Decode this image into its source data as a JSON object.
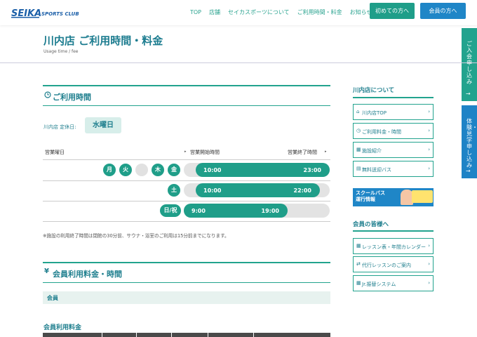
{
  "header": {
    "logo_text": "SEIKA SPORTS CLUB",
    "nav": [
      "TOP",
      "店舗",
      "セイカスポーツについて",
      "ご利用時間・料金",
      "お知らせ"
    ],
    "btn_first": "初めての方へ",
    "btn_member": "会員の方へ"
  },
  "side_tabs": {
    "apply": "ご入会申し込み",
    "trial": "体験・見学申し込み",
    "arrow": "→"
  },
  "page": {
    "title": "川内店 ご利用時間・料金",
    "subtitle": "Usage time / fee"
  },
  "hours": {
    "heading": "ご利用時間",
    "holiday_label": "川内店 定休日:",
    "holiday_value": "水曜日",
    "col_day": "営業曜日",
    "col_start": "営業開始時間",
    "col_end": "営業終了時間",
    "rows": [
      {
        "days": [
          "月",
          "火",
          "",
          "木",
          "金"
        ],
        "start": "10:00",
        "end": "23:00"
      },
      {
        "days": [
          "土"
        ],
        "start": "10:00",
        "end": "22:00"
      },
      {
        "days": [
          "日/祝"
        ],
        "start": "9:00",
        "end": "19:00"
      }
    ],
    "note": "※施設の利用終了時間は閉館の30分前、サウナ・浴室のご利用は15分前までになります。"
  },
  "fees": {
    "heading": "会員利用料金・時間",
    "icon": "¥",
    "member_label": "会員",
    "fee_title": "会員利用料金"
  },
  "sidebar": {
    "about_title": "川内店について",
    "about_links": [
      {
        "icon": "home-icon",
        "glyph": "⌂",
        "label": "川内店TOP"
      },
      {
        "icon": "clock-icon",
        "glyph": "◷",
        "label": "ご利用料金・時間"
      },
      {
        "icon": "building-icon",
        "glyph": "▦",
        "label": "施設紹介"
      },
      {
        "icon": "bus-icon",
        "glyph": "▤",
        "label": "無料送迎バス"
      }
    ],
    "banner_text": "スクールバス\n運行情報",
    "members_title": "会員の皆様へ",
    "member_links": [
      {
        "icon": "calendar-icon",
        "glyph": "▦",
        "label": "レッスン表・年間カレンダー"
      },
      {
        "icon": "swap-icon",
        "glyph": "⇄",
        "label": "代行レッスンのご案内"
      },
      {
        "icon": "calendar-icon",
        "glyph": "▦",
        "label": "Jr.振替システム"
      }
    ],
    "chevron": "›"
  },
  "colors": {
    "accent": "#1f9e89",
    "blue": "#1f86c7",
    "title": "#1c7c8f"
  }
}
